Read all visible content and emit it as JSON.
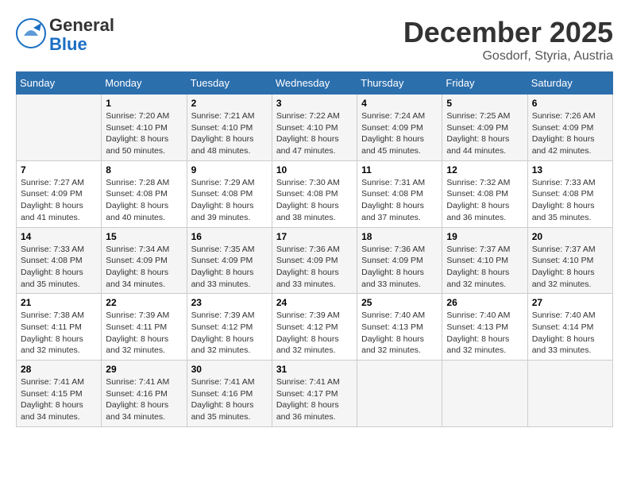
{
  "logo": {
    "general": "General",
    "blue": "Blue"
  },
  "header": {
    "month": "December 2025",
    "location": "Gosdorf, Styria, Austria"
  },
  "days_of_week": [
    "Sunday",
    "Monday",
    "Tuesday",
    "Wednesday",
    "Thursday",
    "Friday",
    "Saturday"
  ],
  "weeks": [
    [
      {
        "day": "",
        "info": ""
      },
      {
        "day": "1",
        "info": "Sunrise: 7:20 AM\nSunset: 4:10 PM\nDaylight: 8 hours\nand 50 minutes."
      },
      {
        "day": "2",
        "info": "Sunrise: 7:21 AM\nSunset: 4:10 PM\nDaylight: 8 hours\nand 48 minutes."
      },
      {
        "day": "3",
        "info": "Sunrise: 7:22 AM\nSunset: 4:10 PM\nDaylight: 8 hours\nand 47 minutes."
      },
      {
        "day": "4",
        "info": "Sunrise: 7:24 AM\nSunset: 4:09 PM\nDaylight: 8 hours\nand 45 minutes."
      },
      {
        "day": "5",
        "info": "Sunrise: 7:25 AM\nSunset: 4:09 PM\nDaylight: 8 hours\nand 44 minutes."
      },
      {
        "day": "6",
        "info": "Sunrise: 7:26 AM\nSunset: 4:09 PM\nDaylight: 8 hours\nand 42 minutes."
      }
    ],
    [
      {
        "day": "7",
        "info": "Sunrise: 7:27 AM\nSunset: 4:09 PM\nDaylight: 8 hours\nand 41 minutes."
      },
      {
        "day": "8",
        "info": "Sunrise: 7:28 AM\nSunset: 4:08 PM\nDaylight: 8 hours\nand 40 minutes."
      },
      {
        "day": "9",
        "info": "Sunrise: 7:29 AM\nSunset: 4:08 PM\nDaylight: 8 hours\nand 39 minutes."
      },
      {
        "day": "10",
        "info": "Sunrise: 7:30 AM\nSunset: 4:08 PM\nDaylight: 8 hours\nand 38 minutes."
      },
      {
        "day": "11",
        "info": "Sunrise: 7:31 AM\nSunset: 4:08 PM\nDaylight: 8 hours\nand 37 minutes."
      },
      {
        "day": "12",
        "info": "Sunrise: 7:32 AM\nSunset: 4:08 PM\nDaylight: 8 hours\nand 36 minutes."
      },
      {
        "day": "13",
        "info": "Sunrise: 7:33 AM\nSunset: 4:08 PM\nDaylight: 8 hours\nand 35 minutes."
      }
    ],
    [
      {
        "day": "14",
        "info": "Sunrise: 7:33 AM\nSunset: 4:08 PM\nDaylight: 8 hours\nand 35 minutes."
      },
      {
        "day": "15",
        "info": "Sunrise: 7:34 AM\nSunset: 4:09 PM\nDaylight: 8 hours\nand 34 minutes."
      },
      {
        "day": "16",
        "info": "Sunrise: 7:35 AM\nSunset: 4:09 PM\nDaylight: 8 hours\nand 33 minutes."
      },
      {
        "day": "17",
        "info": "Sunrise: 7:36 AM\nSunset: 4:09 PM\nDaylight: 8 hours\nand 33 minutes."
      },
      {
        "day": "18",
        "info": "Sunrise: 7:36 AM\nSunset: 4:09 PM\nDaylight: 8 hours\nand 33 minutes."
      },
      {
        "day": "19",
        "info": "Sunrise: 7:37 AM\nSunset: 4:10 PM\nDaylight: 8 hours\nand 32 minutes."
      },
      {
        "day": "20",
        "info": "Sunrise: 7:37 AM\nSunset: 4:10 PM\nDaylight: 8 hours\nand 32 minutes."
      }
    ],
    [
      {
        "day": "21",
        "info": "Sunrise: 7:38 AM\nSunset: 4:11 PM\nDaylight: 8 hours\nand 32 minutes."
      },
      {
        "day": "22",
        "info": "Sunrise: 7:39 AM\nSunset: 4:11 PM\nDaylight: 8 hours\nand 32 minutes."
      },
      {
        "day": "23",
        "info": "Sunrise: 7:39 AM\nSunset: 4:12 PM\nDaylight: 8 hours\nand 32 minutes."
      },
      {
        "day": "24",
        "info": "Sunrise: 7:39 AM\nSunset: 4:12 PM\nDaylight: 8 hours\nand 32 minutes."
      },
      {
        "day": "25",
        "info": "Sunrise: 7:40 AM\nSunset: 4:13 PM\nDaylight: 8 hours\nand 32 minutes."
      },
      {
        "day": "26",
        "info": "Sunrise: 7:40 AM\nSunset: 4:13 PM\nDaylight: 8 hours\nand 32 minutes."
      },
      {
        "day": "27",
        "info": "Sunrise: 7:40 AM\nSunset: 4:14 PM\nDaylight: 8 hours\nand 33 minutes."
      }
    ],
    [
      {
        "day": "28",
        "info": "Sunrise: 7:41 AM\nSunset: 4:15 PM\nDaylight: 8 hours\nand 34 minutes."
      },
      {
        "day": "29",
        "info": "Sunrise: 7:41 AM\nSunset: 4:16 PM\nDaylight: 8 hours\nand 34 minutes."
      },
      {
        "day": "30",
        "info": "Sunrise: 7:41 AM\nSunset: 4:16 PM\nDaylight: 8 hours\nand 35 minutes."
      },
      {
        "day": "31",
        "info": "Sunrise: 7:41 AM\nSunset: 4:17 PM\nDaylight: 8 hours\nand 36 minutes."
      },
      {
        "day": "",
        "info": ""
      },
      {
        "day": "",
        "info": ""
      },
      {
        "day": "",
        "info": ""
      }
    ]
  ]
}
